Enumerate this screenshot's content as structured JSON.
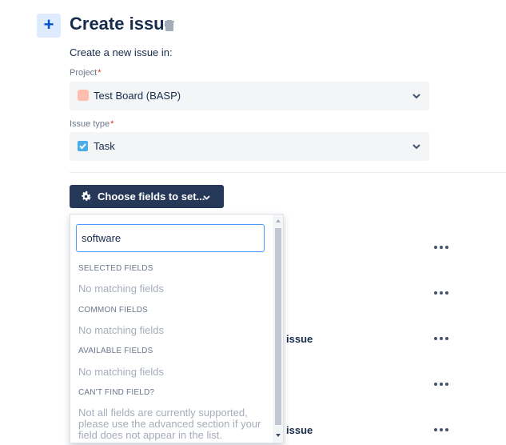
{
  "header": {
    "add_icon": "plus-icon",
    "title": "Create issue",
    "trash_icon": "trash-icon"
  },
  "form": {
    "intro": "Create a new issue in:",
    "project": {
      "label": "Project",
      "required_mark": "*",
      "value": "Test Board (BASP)",
      "icon": "project-avatar-icon"
    },
    "issue_type": {
      "label": "Issue type",
      "required_mark": "*",
      "value": "Task",
      "icon": "task-checkbox-icon"
    }
  },
  "choose_fields": {
    "label": "Choose fields to set...",
    "icon": "gear-icon"
  },
  "dropdown": {
    "search_value": "software",
    "sections": [
      {
        "heading": "SELECTED FIELDS",
        "empty": "No matching fields"
      },
      {
        "heading": "COMMON FIELDS",
        "empty": "No matching fields"
      },
      {
        "heading": "AVAILABLE FIELDS",
        "empty": "No matching fields"
      }
    ],
    "cant_find": {
      "heading": "CAN'T FIND FIELD?",
      "text": "Not all fields are currently supported, please use the advanced section if your field does not appear in the list."
    }
  },
  "background_rows": {
    "issue_label_1": "issue",
    "issue_label_2": "issue"
  },
  "colors": {
    "primary_button": "#253858",
    "accent": "#4c9aff",
    "required": "#de350b"
  }
}
